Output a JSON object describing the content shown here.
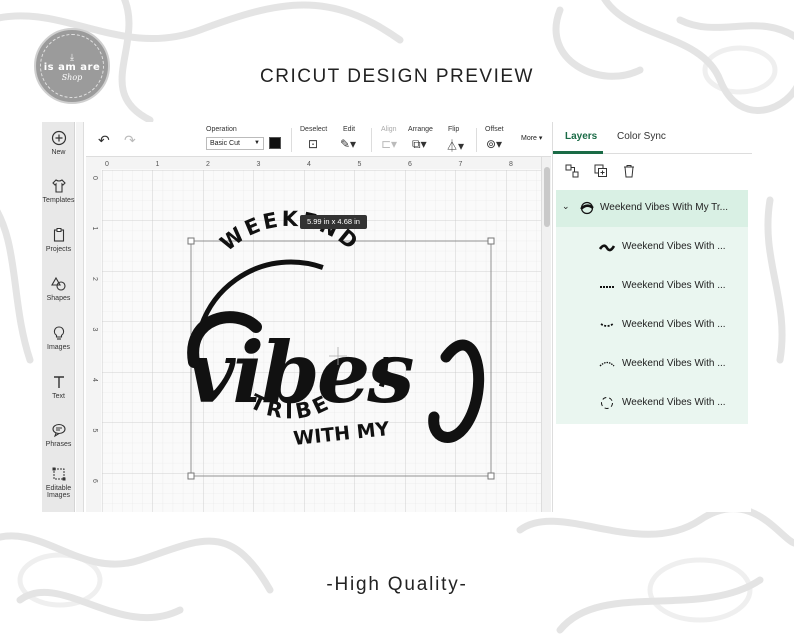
{
  "page": {
    "title": "CRICUT DESIGN PREVIEW",
    "footer": "-High Quality-"
  },
  "logo": {
    "name": "is am are",
    "script": "Shop"
  },
  "sidebar": {
    "items": [
      {
        "label": "New",
        "icon": "plus-circle-icon"
      },
      {
        "label": "Templates",
        "icon": "shirt-icon"
      },
      {
        "label": "Projects",
        "icon": "clipboard-icon"
      },
      {
        "label": "Shapes",
        "icon": "shapes-icon"
      },
      {
        "label": "Images",
        "icon": "bulb-icon"
      },
      {
        "label": "Text",
        "icon": "text-icon"
      },
      {
        "label": "Phrases",
        "icon": "speech-icon"
      },
      {
        "label": "Editable Images",
        "icon": "transform-icon"
      }
    ]
  },
  "toolbar": {
    "operation_label": "Operation",
    "operation_value": "Basic Cut",
    "operation_color": "#111111",
    "deselect_label": "Deselect",
    "edit_label": "Edit",
    "align_label": "Align",
    "arrange_label": "Arrange",
    "flip_label": "Flip",
    "offset_label": "Offset",
    "more_label": "More"
  },
  "canvas": {
    "selection_size": "5.99  in x 4.68  in",
    "ruler_top": [
      "0",
      "1",
      "2",
      "3",
      "4",
      "5",
      "6",
      "7",
      "8"
    ],
    "ruler_left": [
      "0",
      "1",
      "2",
      "3",
      "4",
      "5",
      "6"
    ],
    "design": {
      "arc_top": "WEEKEND",
      "main_word": "vibes",
      "middle": "WITH MY",
      "arc_bottom": "TRIBE"
    }
  },
  "panel": {
    "tabs": [
      {
        "label": "Layers",
        "active": true
      },
      {
        "label": "Color Sync",
        "active": false
      }
    ],
    "group_name": "Weekend Vibes With My Tr...",
    "layers": [
      {
        "name": "Weekend Vibes With ...",
        "thumb": "vibes"
      },
      {
        "name": "Weekend Vibes With ...",
        "thumb": "with-my"
      },
      {
        "name": "Weekend Vibes With ...",
        "thumb": "tribe"
      },
      {
        "name": "Weekend Vibes With ...",
        "thumb": "weekend-arc"
      },
      {
        "name": "Weekend Vibes With ...",
        "thumb": "circle"
      }
    ]
  },
  "colors": {
    "accent": "#1a6b46",
    "layer_bg": "#eaf6f0",
    "group_bg": "#d9f0e4",
    "sidebar_bg": "#e8e8e8"
  }
}
